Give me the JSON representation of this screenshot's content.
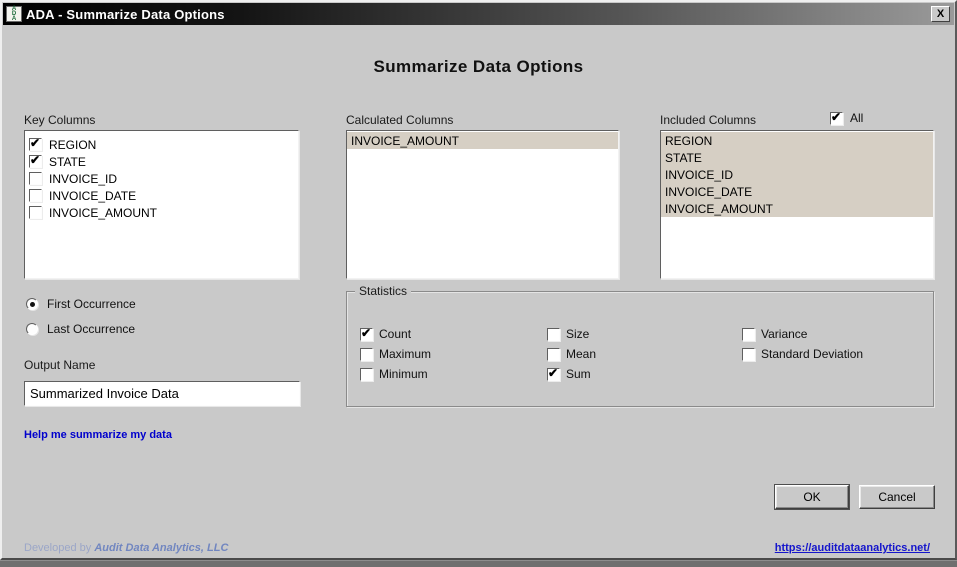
{
  "window": {
    "title": "ADA - Summarize Data Options",
    "icon": "ada-logo",
    "close_glyph": "X"
  },
  "heading": "Summarize Data Options",
  "key_columns": {
    "label": "Key Columns",
    "items": [
      {
        "label": "REGION",
        "checked": true
      },
      {
        "label": "STATE",
        "checked": true
      },
      {
        "label": "INVOICE_ID",
        "checked": false
      },
      {
        "label": "INVOICE_DATE",
        "checked": false
      },
      {
        "label": "INVOICE_AMOUNT",
        "checked": false
      }
    ]
  },
  "calculated_columns": {
    "label": "Calculated Columns",
    "items": [
      {
        "label": "INVOICE_AMOUNT",
        "selected": true
      }
    ]
  },
  "included_columns": {
    "label": "Included Columns",
    "all_label": "All",
    "all_checked": true,
    "items": [
      {
        "label": "REGION",
        "selected": true
      },
      {
        "label": "STATE",
        "selected": true
      },
      {
        "label": "INVOICE_ID",
        "selected": true
      },
      {
        "label": "INVOICE_DATE",
        "selected": true
      },
      {
        "label": "INVOICE_AMOUNT",
        "selected": true
      }
    ]
  },
  "occurrence": {
    "options": [
      {
        "label": "First Occurrence",
        "selected": true
      },
      {
        "label": "Last Occurrence",
        "selected": false
      }
    ]
  },
  "output_name": {
    "label": "Output Name",
    "value": "Summarized Invoice Data"
  },
  "statistics": {
    "label": "Statistics",
    "columns": [
      [
        {
          "label": "Count",
          "checked": true
        },
        {
          "label": "Maximum",
          "checked": false
        },
        {
          "label": "Minimum",
          "checked": false
        }
      ],
      [
        {
          "label": "Size",
          "checked": false
        },
        {
          "label": "Mean",
          "checked": false
        },
        {
          "label": "Sum",
          "checked": true
        }
      ],
      [
        {
          "label": "Variance",
          "checked": false
        },
        {
          "label": "Standard Deviation",
          "checked": false
        }
      ]
    ]
  },
  "help_link": "Help me summarize my data",
  "buttons": {
    "ok": "OK",
    "cancel": "Cancel"
  },
  "footer": {
    "developed_by": "Developed by",
    "company": "Audit Data Analytics, LLC",
    "url": "https://auditdataanalytics.net/"
  },
  "colors": {
    "dialog_background": "#c9c9c9",
    "list_selection": "#d6cfc4",
    "titlebar_gradient_start": "#000000",
    "titlebar_gradient_end": "#9a9a9a",
    "link_blue": "#0000cd",
    "footer_text": "#9ba6c8",
    "footer_brand": "#7186c0"
  }
}
